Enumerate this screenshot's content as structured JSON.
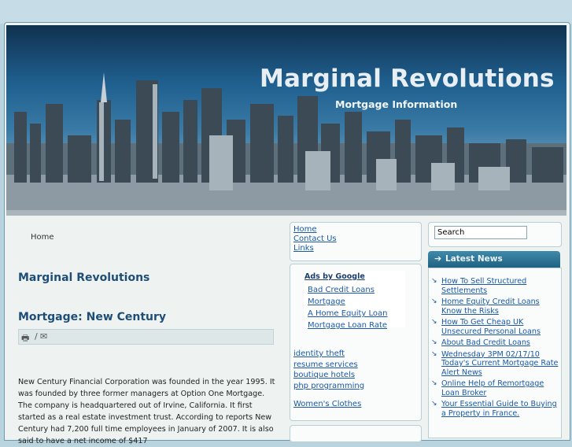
{
  "site": {
    "title": "Marginal Revolutions",
    "subtitle": "Mortgage Information"
  },
  "breadcrumb": "Home",
  "main": {
    "site_heading": "Marginal Revolutions",
    "post_title": "Mortgage: New Century",
    "toolbar_separator": "/",
    "body": "New Century Financial Corporation was founded in the year 1995. It was founded by three former managers at Option One Mortgage. The company is headquartered out of Irvine, California. It first started as a real estate investment trust. According to reports New Century had 7,200 full time employees in January of 2007. It is also said to have a net income of $417"
  },
  "nav": {
    "items": [
      "Home",
      "Contact Us",
      "Links"
    ]
  },
  "ads": {
    "title": "Ads by Google",
    "items": [
      "Bad Credit Loans",
      "Mortgage",
      "A Home Equity Loan",
      "Mortgage Loan Rate"
    ]
  },
  "links": {
    "group1": [
      "identity theft",
      "resume services",
      "boutique hotels",
      "php programming"
    ],
    "group2": [
      "Women's Clothes"
    ]
  },
  "search": {
    "value": "Search"
  },
  "news": {
    "title": "Latest News",
    "items": [
      "How To Sell Structured Settlements",
      "Home Equity Credit Loans Know the Risks",
      "How To Get Cheap UK Unsecured Personal Loans",
      "About Bad Credit Loans",
      "Wednesday 3PM 02/17/10 Today's Current Mortgage Rate Alert News",
      "Online Help of Remortgage Loan Broker",
      "Your Essential Guide to Buying a Property in France."
    ]
  },
  "colors": {
    "link": "#1b58a6",
    "heading": "#1e4e78",
    "accent": "#2a6f92"
  }
}
